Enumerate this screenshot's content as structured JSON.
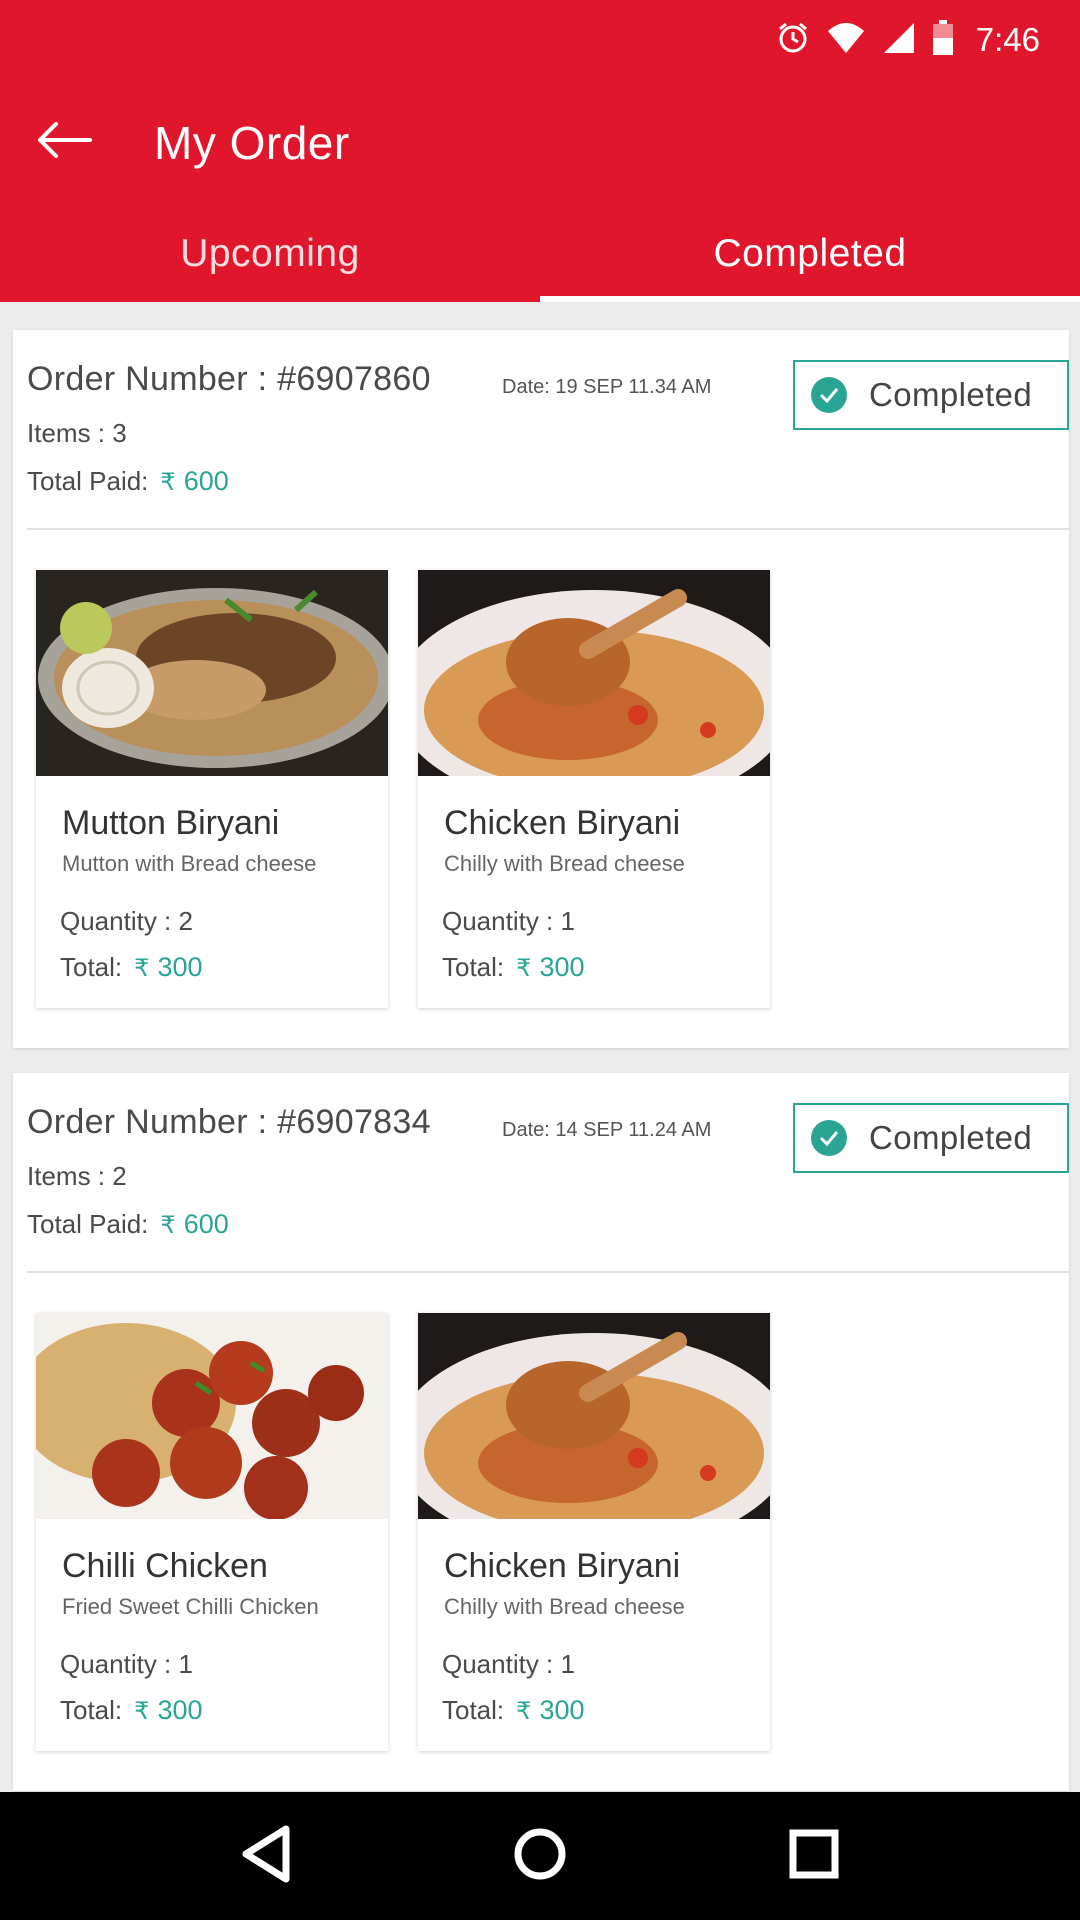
{
  "status_bar": {
    "time": "7:46",
    "icons": [
      "alarm-icon",
      "wifi-icon",
      "signal-icon",
      "battery-icon"
    ]
  },
  "header": {
    "title": "My Order",
    "back_icon": "back-arrow-icon"
  },
  "tabs": [
    {
      "label": "Upcoming",
      "active": false
    },
    {
      "label": "Completed",
      "active": true
    }
  ],
  "orders": [
    {
      "number": "Order Number : #6907860",
      "date": "Date: 19 SEP 11.34 AM",
      "items": "Items : 3",
      "total_label": "Total Paid:",
      "currency": "₹",
      "total": "600",
      "status": "Completed",
      "products": [
        {
          "name": "Mutton Biryani",
          "desc": "Mutton with Bread cheese",
          "qty": "Quantity : 2",
          "total_label": "Total:",
          "total": "300"
        },
        {
          "name": "Chicken Biryani",
          "desc": "Chilly with Bread cheese",
          "qty": "Quantity : 1",
          "total_label": "Total:",
          "total": "300"
        }
      ]
    },
    {
      "number": "Order Number : #6907834",
      "date": "Date: 14 SEP 11.24 AM",
      "items": "Items : 2",
      "total_label": "Total Paid:",
      "currency": "₹",
      "total": "600",
      "status": "Completed",
      "products": [
        {
          "name": "Chilli Chicken",
          "desc": "Fried Sweet Chilli Chicken",
          "qty": "Quantity : 1",
          "total_label": "Total:",
          "total": "300"
        },
        {
          "name": "Chicken Biryani",
          "desc": "Chilly with Bread cheese",
          "qty": "Quantity : 1",
          "total_label": "Total:",
          "total": "300"
        }
      ]
    }
  ],
  "colors": {
    "primary": "#e0172c",
    "accent": "#2aa595",
    "navbar": "#000000"
  }
}
